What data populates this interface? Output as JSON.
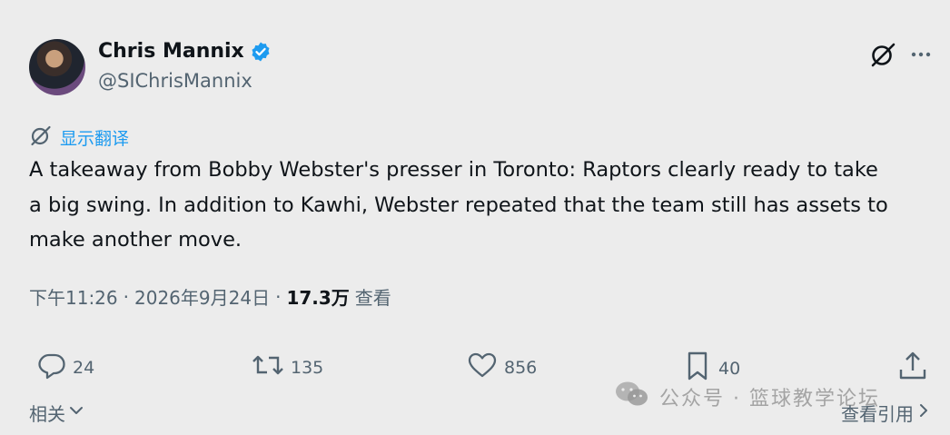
{
  "user": {
    "name": "Chris Mannix",
    "handle": "@SIChrisMannix"
  },
  "translate": {
    "label": "显示翻译"
  },
  "tweet": {
    "text": "A takeaway from Bobby Webster's presser in Toronto: Raptors clearly ready to take\na big swing. In addition to Kawhi, Webster repeated that the team still has assets to\nmake another move."
  },
  "meta": {
    "time": "下午11:26",
    "sep1": "·",
    "date": "2026年9月24日",
    "sep2": "·",
    "views_count": "17.3万",
    "views_label": "查看"
  },
  "actions": {
    "reply_count": "24",
    "retweet_count": "135",
    "like_count": "856",
    "bookmark_count": "40"
  },
  "footer": {
    "related_label": "相关",
    "view_quotes_label": "查看引用"
  },
  "watermark": {
    "text": "公众号 · 篮球教学论坛"
  },
  "colors": {
    "accent": "#1d9bf0",
    "muted": "#536471",
    "text": "#0f1419",
    "background": "#ececec"
  },
  "icons": [
    "verified-badge-icon",
    "grok-icon",
    "more-icon",
    "translate-icon",
    "reply-icon",
    "retweet-icon",
    "like-icon",
    "bookmark-icon",
    "share-icon",
    "chevron-down-icon",
    "chevron-right-icon",
    "wechat-icon"
  ]
}
